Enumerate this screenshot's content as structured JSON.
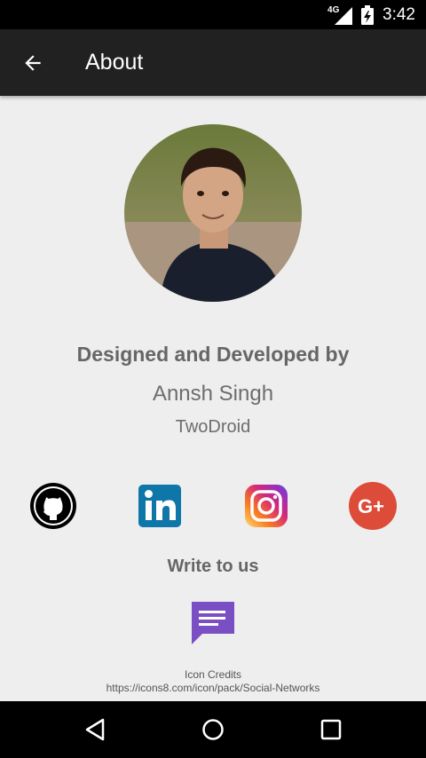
{
  "status_bar": {
    "network": "4G",
    "time": "3:42"
  },
  "app_bar": {
    "title": "About"
  },
  "profile": {
    "designed_label": "Designed and Developed by",
    "name": "Annsh Singh",
    "company": "TwoDroid"
  },
  "social": [
    {
      "name": "github",
      "icon": "github-icon"
    },
    {
      "name": "linkedin",
      "icon": "linkedin-icon"
    },
    {
      "name": "instagram",
      "icon": "instagram-icon"
    },
    {
      "name": "google-plus",
      "icon": "google-plus-icon"
    }
  ],
  "contact": {
    "write_label": "Write to us",
    "icon": "message-icon"
  },
  "credits": {
    "title": "Icon Credits",
    "url": "https://icons8.com/icon/pack/Social-Networks"
  },
  "colors": {
    "app_bar": "#212121",
    "background": "#eeeeee",
    "linkedin": "#0e76a8",
    "google_plus": "#dd4b39",
    "message": "#7b4fc4"
  }
}
